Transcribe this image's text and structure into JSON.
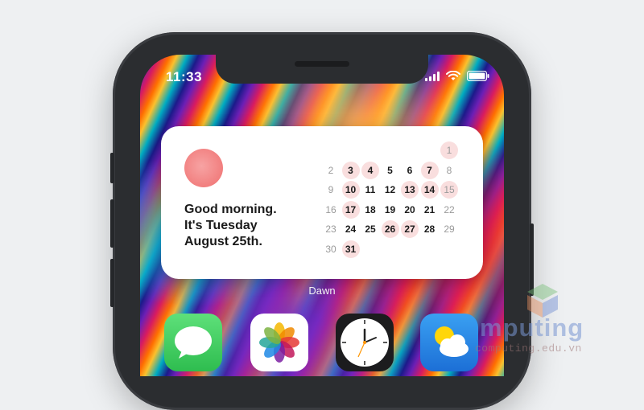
{
  "status_bar": {
    "time": "11:33",
    "icons": [
      "signal-icon",
      "wifi-icon",
      "battery-icon"
    ]
  },
  "widget": {
    "greeting_lines": [
      "Good morning.",
      "It's Tuesday",
      "August 25th."
    ],
    "accent_color": "#ef6f6f",
    "calendar": {
      "rows": [
        [
          null,
          null,
          null,
          null,
          null,
          null,
          {
            "d": "1",
            "muted": true,
            "hl": true
          }
        ],
        [
          {
            "d": "2",
            "muted": true
          },
          {
            "d": "3",
            "hl": true
          },
          {
            "d": "4",
            "hl": true
          },
          {
            "d": "5"
          },
          {
            "d": "6"
          },
          {
            "d": "7",
            "hl": true
          },
          {
            "d": "8",
            "muted": true
          }
        ],
        [
          {
            "d": "9",
            "muted": true
          },
          {
            "d": "10",
            "hl": true
          },
          {
            "d": "11"
          },
          {
            "d": "12"
          },
          {
            "d": "13",
            "hl": true
          },
          {
            "d": "14",
            "hl": true
          },
          {
            "d": "15",
            "muted": true,
            "hl": true
          }
        ],
        [
          {
            "d": "16",
            "muted": true
          },
          {
            "d": "17",
            "hl": true
          },
          {
            "d": "18"
          },
          {
            "d": "19"
          },
          {
            "d": "20"
          },
          {
            "d": "21"
          },
          {
            "d": "22",
            "muted": true
          }
        ],
        [
          {
            "d": "23",
            "muted": true
          },
          {
            "d": "24"
          },
          {
            "d": "25"
          },
          {
            "d": "26",
            "hl": true
          },
          {
            "d": "27",
            "hl": true
          },
          {
            "d": "28"
          },
          {
            "d": "29",
            "muted": true
          }
        ],
        [
          {
            "d": "30",
            "muted": true
          },
          {
            "d": "31",
            "hl": true
          }
        ]
      ]
    }
  },
  "widget_label": "Dawn",
  "dock_apps": [
    {
      "name": "messages-icon",
      "color": "#34c759"
    },
    {
      "name": "photos-icon",
      "color": "#ffffff"
    },
    {
      "name": "clock-icon",
      "color": "#1c1c1e"
    },
    {
      "name": "weather-icon",
      "color": "#2f8fe8"
    }
  ],
  "watermark": {
    "text": "mputing",
    "sub": "computing.edu.vn"
  }
}
